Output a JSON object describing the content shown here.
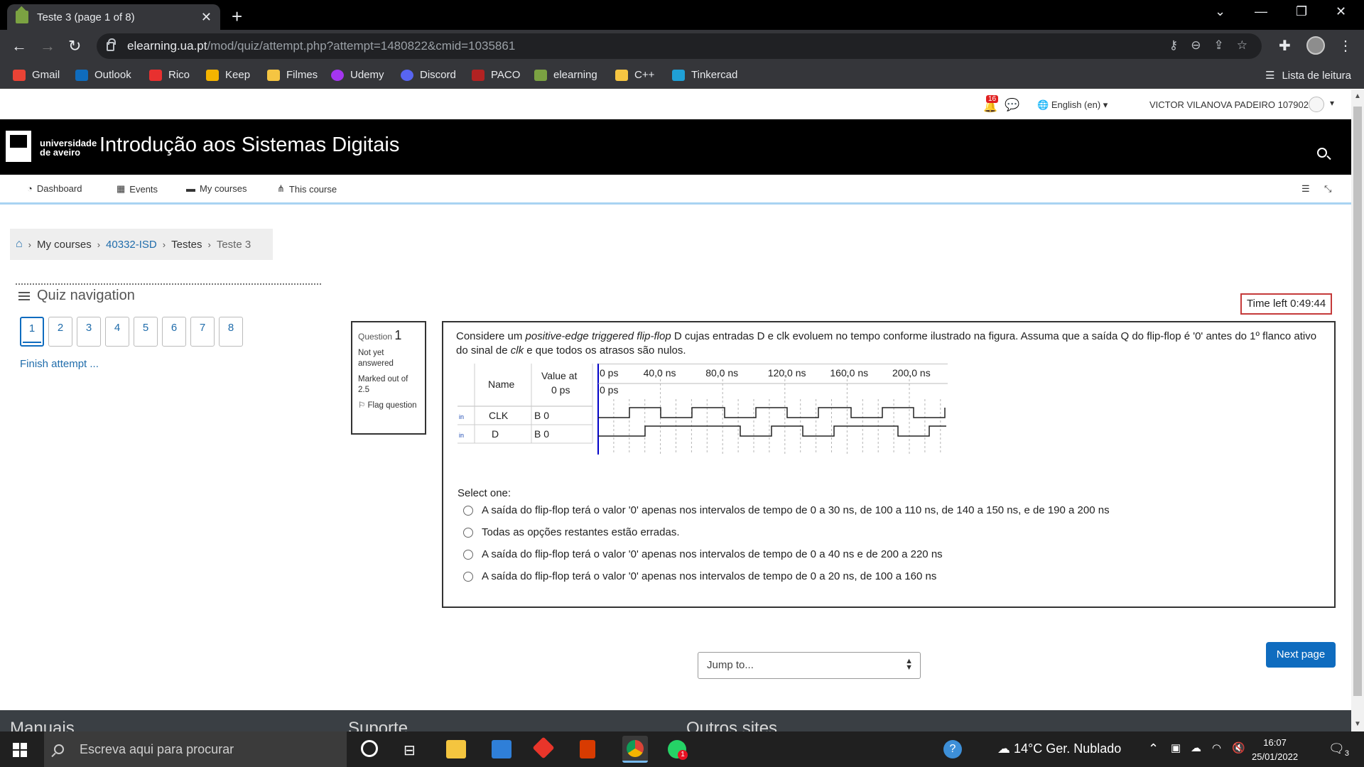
{
  "browser": {
    "tab_title": "Teste 3 (page 1 of 8)",
    "url_host": "elearning.ua.pt",
    "url_path": "/mod/quiz/attempt.php?attempt=1480822&cmid=1035861",
    "bookmarks": [
      {
        "label": "Gmail",
        "color": "#ea4335"
      },
      {
        "label": "Outlook",
        "color": "#0f6cbd"
      },
      {
        "label": "Rico",
        "color": "#e8302f"
      },
      {
        "label": "Keep",
        "color": "#f4b400"
      },
      {
        "label": "Filmes",
        "color": "#f5c542"
      },
      {
        "label": "Udemy",
        "color": "#a435f0"
      },
      {
        "label": "Discord",
        "color": "#5865f2"
      },
      {
        "label": "PACO",
        "color": "#b22222"
      },
      {
        "label": "elearning",
        "color": "#7ba242"
      },
      {
        "label": "C++",
        "color": "#f5c542"
      },
      {
        "label": "Tinkercad",
        "color": "#1fa0d6"
      }
    ],
    "reading_list": "Lista de leitura"
  },
  "moodle": {
    "notifications_count": "16",
    "language": "English (en)",
    "user_name": "VICTOR VILANOVA PADEIRO 107902",
    "logo_line1": "universidade",
    "logo_line2": "de aveiro",
    "course_title": "Introdução aos Sistemas Digitais",
    "nav": [
      "Dashboard",
      "Events",
      "My courses",
      "This course"
    ],
    "breadcrumb": [
      "My courses",
      "40332-ISD",
      "Testes",
      "Teste 3"
    ],
    "quiz_nav_title": "Quiz navigation",
    "questions": [
      "1",
      "2",
      "3",
      "4",
      "5",
      "6",
      "7",
      "8"
    ],
    "finish_attempt": "Finish attempt ...",
    "qinfo": {
      "label": "Question",
      "number": "1",
      "status": "Not yet answered",
      "marked": "Marked out of 2.5",
      "flag": "Flag question"
    },
    "time_left": "Time left 0:49:44",
    "question_text": {
      "p1": "Considere um ",
      "em1": "positive-edge triggered flip-flop",
      "p2": " D cujas entradas D e clk evoluem no tempo conforme ilustrado na figura. Assuma que a saída Q do flip-flop é '0' antes do 1º flanco ativo do sinal de ",
      "em2": "clk",
      "p3": " e que todos os atrasos são nulos."
    },
    "waveform": {
      "col_name": "Name",
      "col_value_1": "Value at",
      "col_value_2": "0 ps",
      "time_labels": [
        "0 ps",
        "40,0 ns",
        "80,0 ns",
        "120,0 ns",
        "160,0 ns",
        "200,0 ns"
      ],
      "cursor_label": "0 ps",
      "signals": [
        {
          "name": "CLK",
          "value": "B 0",
          "tag": "in"
        },
        {
          "name": "D",
          "value": "B 0",
          "tag": "in"
        }
      ]
    },
    "select_one": "Select one:",
    "options": [
      "A saída do flip-flop terá o valor '0' apenas nos intervalos de tempo de 0 a 30 ns, de 100 a 110 ns, de 140 a 150 ns, e de 190 a 200 ns",
      "Todas as opções restantes estão erradas.",
      "A saída do flip-flop terá o valor '0' apenas nos intervalos de tempo de 0 a 40 ns e de 200 a 220 ns",
      "A saída do flip-flop terá o valor '0' apenas nos intervalos de tempo de 0 a 20 ns, de 100 a 160 ns"
    ],
    "jump_to": "Jump to...",
    "next_page": "Next page",
    "footer_headings": [
      "Manuais",
      "Suporte",
      "Outros sites"
    ]
  },
  "taskbar": {
    "search_placeholder": "Escreva aqui para procurar",
    "weather": "14°C  Ger. Nublado",
    "time": "16:07",
    "date": "25/01/2022",
    "notification_count": "3",
    "whatsapp_badge": "1"
  }
}
